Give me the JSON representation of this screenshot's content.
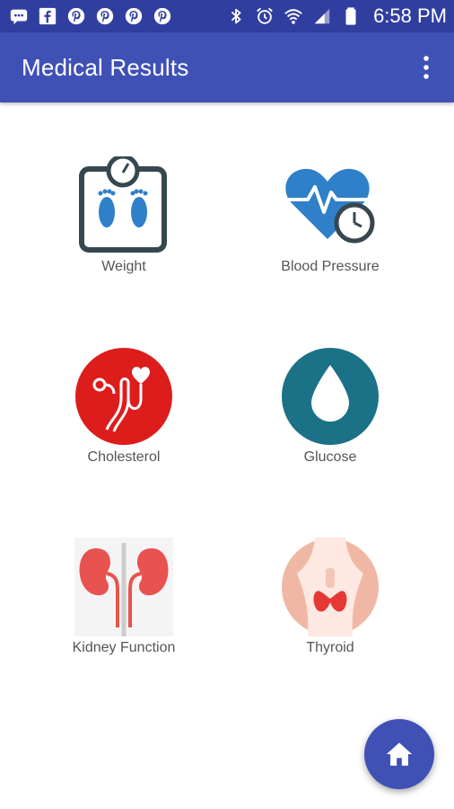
{
  "status_bar": {
    "icons": [
      "message-icon",
      "facebook-icon",
      "pinterest-icon",
      "pinterest-icon",
      "pinterest-icon",
      "pinterest-icon",
      "bluetooth-icon",
      "alarm-icon",
      "wifi-icon",
      "signal-icon",
      "battery-icon"
    ],
    "time": "6:58 PM"
  },
  "app_bar": {
    "title": "Medical Results",
    "menu_icon": "more-vertical-icon"
  },
  "tiles": [
    {
      "label": "Weight",
      "icon": "scale-icon"
    },
    {
      "label": "Blood Pressure",
      "icon": "heart-pressure-icon"
    },
    {
      "label": "Cholesterol",
      "icon": "stethoscope-heart-icon"
    },
    {
      "label": "Glucose",
      "icon": "drop-icon"
    },
    {
      "label": "Kidney Function",
      "icon": "kidneys-icon"
    },
    {
      "label": "Thyroid",
      "icon": "thyroid-icon"
    }
  ],
  "fab": {
    "icon": "home-icon"
  },
  "colors": {
    "status_bar": "#303f9f",
    "app_bar": "#3f51b5",
    "fab": "#3f51b5",
    "cholesterol_red": "#dd1c1c",
    "glucose_teal": "#1b7186",
    "blood_pressure_blue": "#2f80c8",
    "kidney_red": "#e8534f",
    "thyroid_skin": "#f0b8a4"
  }
}
